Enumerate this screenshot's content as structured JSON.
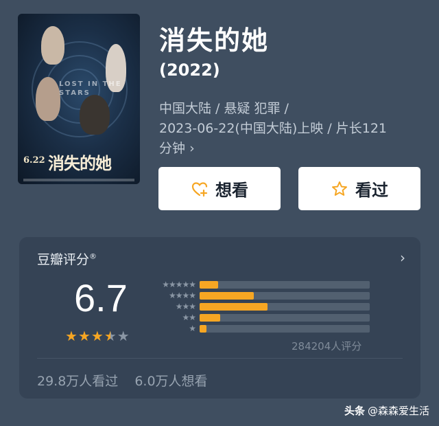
{
  "movie": {
    "title": "消失的她",
    "year": "(2022)",
    "meta_line1": "中国大陆 / 悬疑 犯罪 /",
    "meta_line2": "2023-06-22(中国大陆)上映 / 片长121",
    "meta_line3": "分钟",
    "meta_more_icon": "chevron-right-icon"
  },
  "poster": {
    "date_text": "6.22",
    "title_text": "消失的她",
    "en_title": "LOST IN THE STARS"
  },
  "actions": {
    "want_label": "想看",
    "want_icon": "heart-plus-icon",
    "seen_label": "看过",
    "seen_icon": "star-icon",
    "accent_color": "#f6a623"
  },
  "rating": {
    "label": "豆瓣评分",
    "label_mark": "®",
    "score": "6.7",
    "stars_filled": 3.5,
    "stars_total": 5,
    "distribution": [
      {
        "stars": 5,
        "fraction": 0.11
      },
      {
        "stars": 4,
        "fraction": 0.32
      },
      {
        "stars": 3,
        "fraction": 0.4
      },
      {
        "stars": 2,
        "fraction": 0.12
      },
      {
        "stars": 1,
        "fraction": 0.04
      }
    ],
    "count_text": "284204人评分",
    "seen_text": "29.8万人看过",
    "want_text": "6.0万人想看"
  },
  "watermark": {
    "brand": "头条",
    "handle": "@森森爱生活"
  }
}
